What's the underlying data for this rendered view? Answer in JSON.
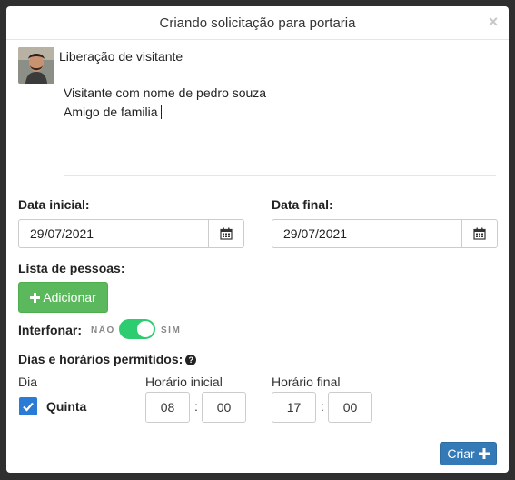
{
  "modal": {
    "title": "Criando solicitação para portaria",
    "close_glyph": "×"
  },
  "request": {
    "title": "Liberação de visitante",
    "message_line1": "Visitante com nome de pedro souza",
    "message_line2": "Amigo de familia"
  },
  "dates": {
    "start_label": "Data inicial:",
    "start_value": "29/07/2021",
    "end_label": "Data final:",
    "end_value": "29/07/2021"
  },
  "people": {
    "label": "Lista de pessoas:",
    "add_button": "Adicionar"
  },
  "intercom": {
    "label": "Interfonar:",
    "off_label": "NÃO",
    "on_label": "SIM",
    "enabled": true
  },
  "schedule": {
    "label": "Dias e horários permitidos:",
    "col_day": "Dia",
    "col_start": "Horário inicial",
    "col_end": "Horário final",
    "rows": [
      {
        "day": "Quinta",
        "checked": true,
        "start_h": "08",
        "start_m": "00",
        "end_h": "17",
        "end_m": "00"
      }
    ]
  },
  "footer": {
    "create_button": "Criar"
  },
  "colors": {
    "add_button": "#5cb85c",
    "create_button": "#337ab7",
    "toggle_on": "#2ecc71",
    "checkbox": "#2a7bd5"
  }
}
